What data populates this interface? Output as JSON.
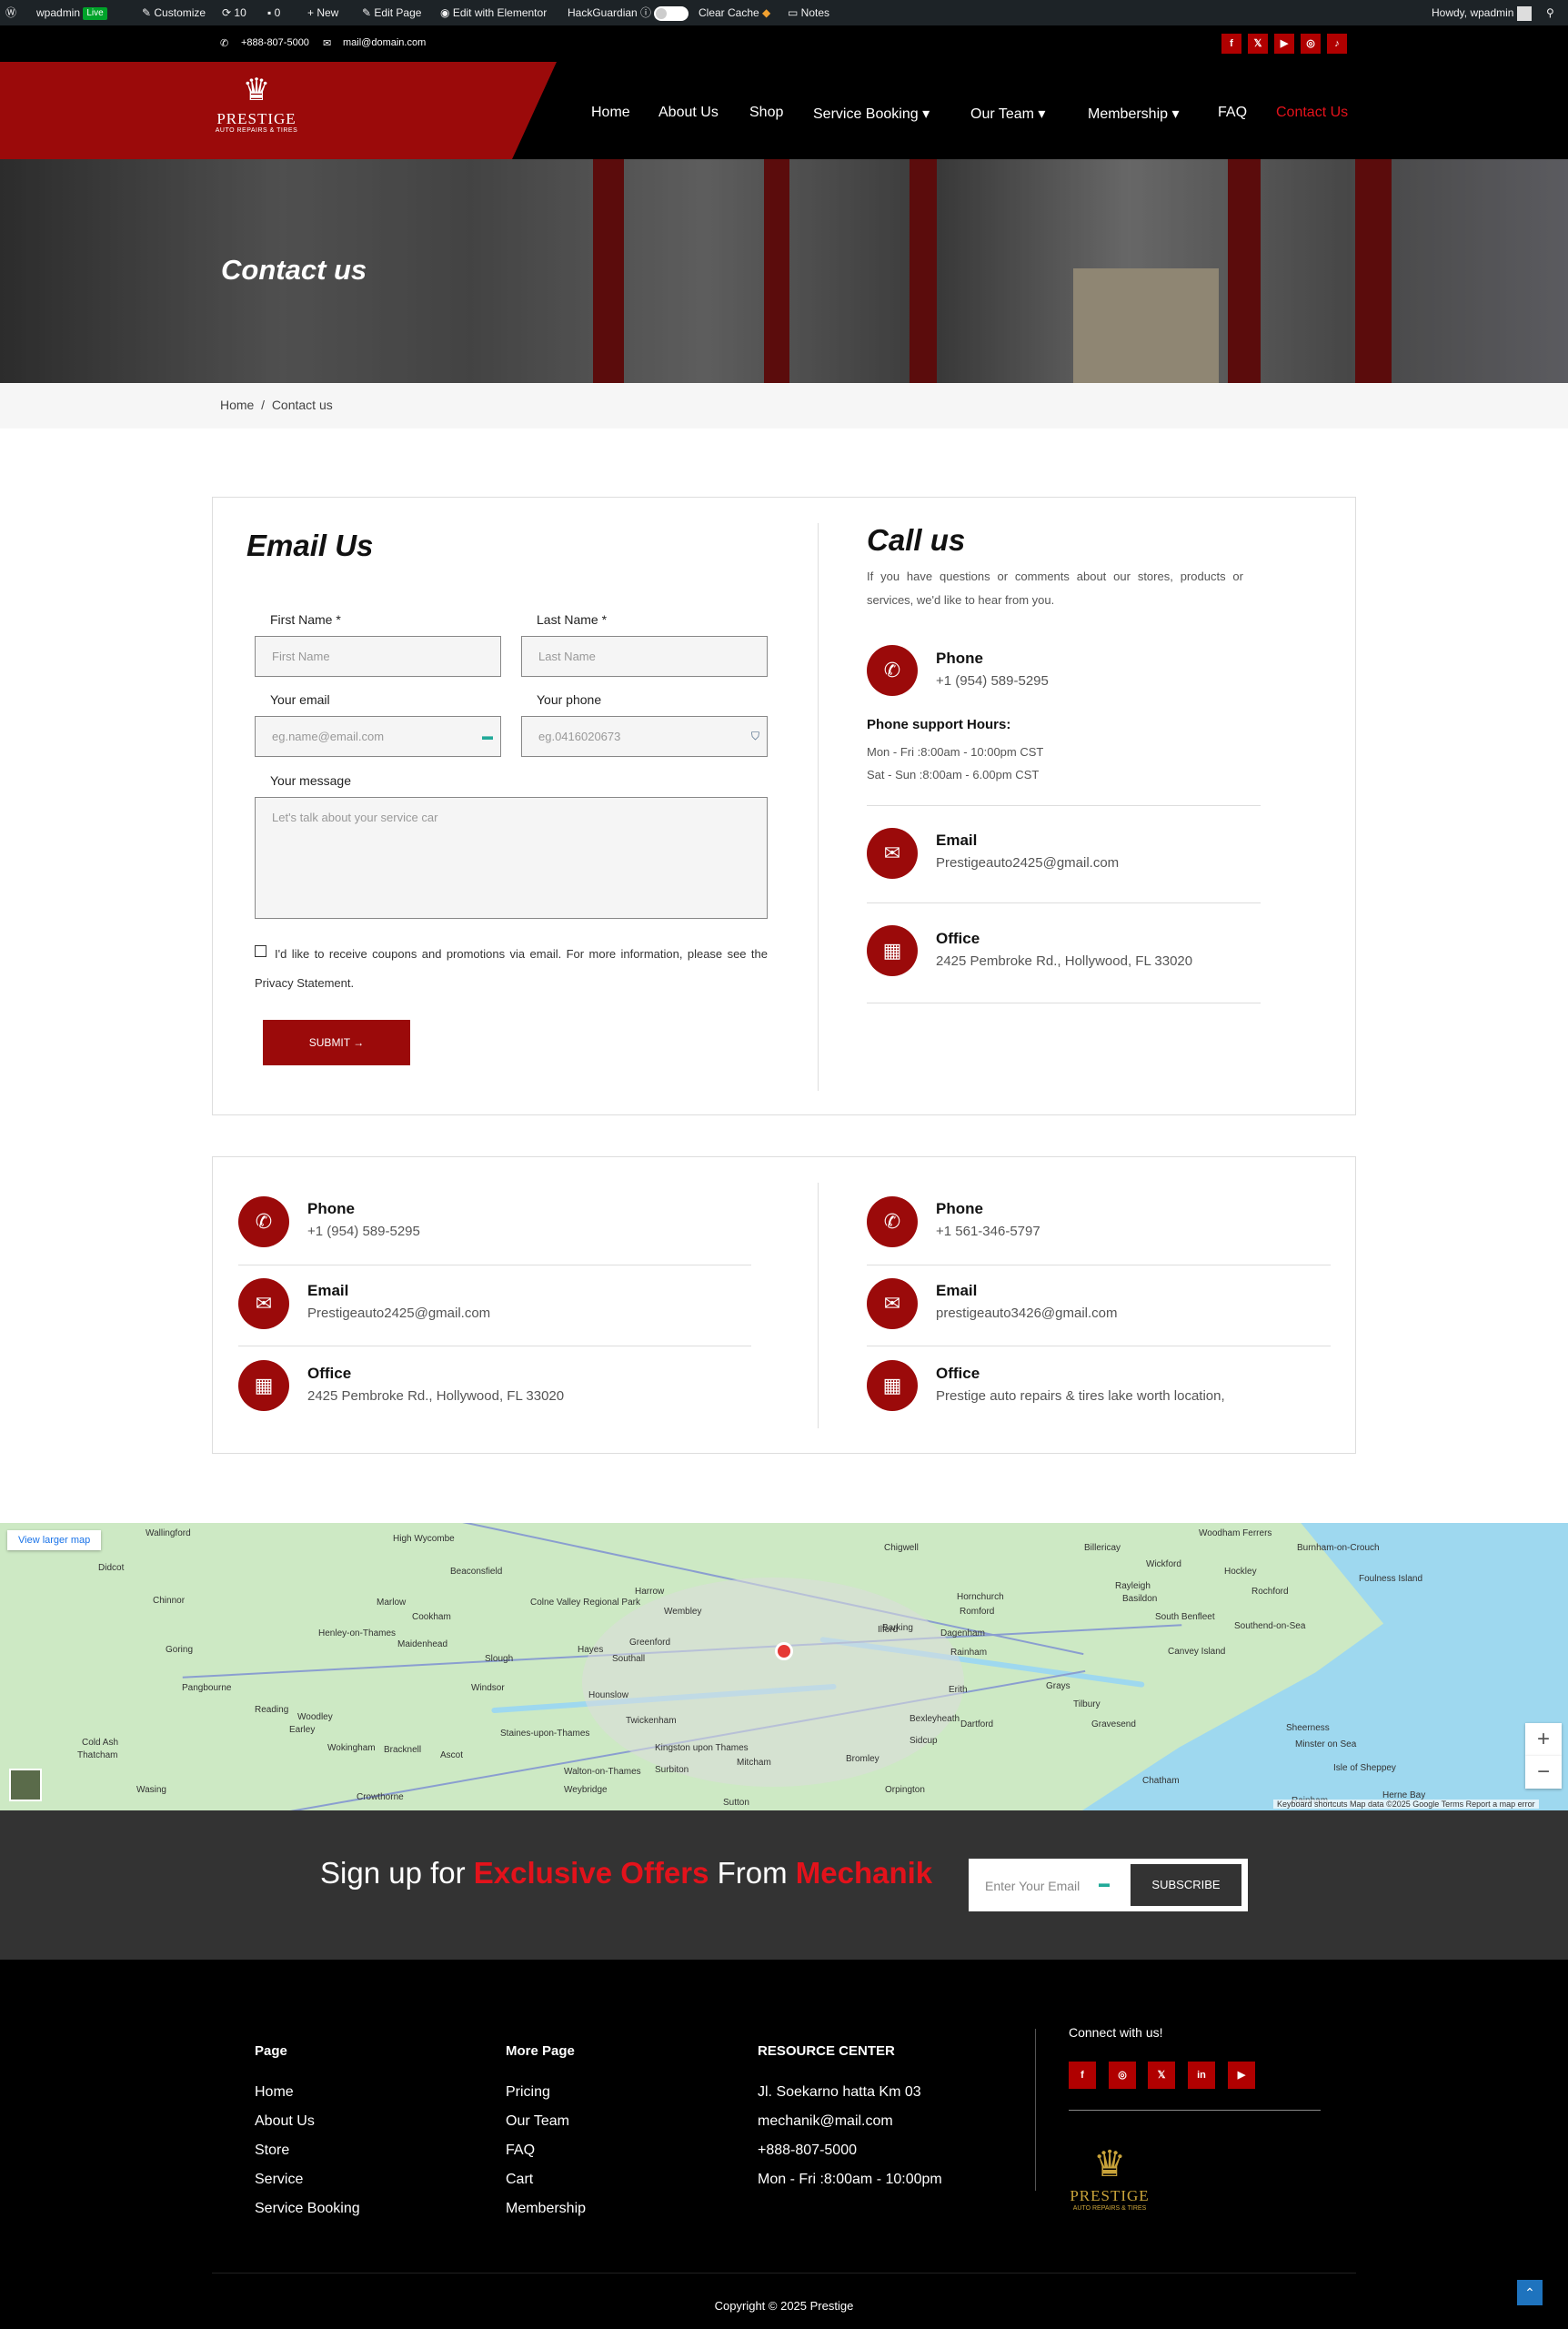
{
  "admin_bar": {
    "site": "wpadmin",
    "live": "Live",
    "customize": "Customize",
    "updates": "10",
    "comments": "0",
    "new": "New",
    "edit_page": "Edit Page",
    "elementor": "Edit with Elementor",
    "hackguardian": "HackGuardian",
    "clear_cache": "Clear Cache",
    "notes": "Notes",
    "howdy": "Howdy, wpadmin"
  },
  "topbar": {
    "phone": "+888-807-5000",
    "email": "mail@domain.com",
    "social": [
      "f",
      "𝕏",
      "▶",
      "◎",
      "♪"
    ]
  },
  "logo": {
    "name": "PRESTIGE",
    "tagline": "AUTO REPAIRS & TIRES"
  },
  "nav": [
    "Home",
    "About Us",
    "Shop",
    "Service Booking",
    "Our Team",
    "Membership",
    "FAQ",
    "Contact Us"
  ],
  "hero": {
    "title": "Contact us"
  },
  "breadcrumb": {
    "home": "Home",
    "sep": "/",
    "current": "Contact us"
  },
  "form": {
    "title": "Email Us",
    "first_label": "First Name",
    "first_placeholder": "First Name",
    "last_label": "Last Name",
    "last_placeholder": "Last Name",
    "required": "*",
    "email_label": "Your email",
    "email_placeholder": "eg.name@email.com",
    "phone_label": "Your phone",
    "phone_placeholder": "eg.0416020673",
    "message_label": "Your message",
    "message_placeholder": "Let's talk about your service car",
    "consent": "I'd like to receive coupons and promotions via email. For more information, please see the Privacy Statement.",
    "submit": "SUBMIT"
  },
  "call": {
    "title": "Call us",
    "intro": "If you have questions or comments about our stores, products or services, we'd like to hear from you.",
    "phone_title": "Phone",
    "phone": "+1 (954) 589-5295",
    "hours_title": "Phone support Hours:",
    "hours_1": "Mon - Fri :8:00am - 10:00pm CST",
    "hours_2": "Sat - Sun :8:00am - 6.00pm CST",
    "email_title": "Email",
    "email": "Prestigeauto2425@gmail.com",
    "office_title": "Office",
    "office": "2425 Pembroke Rd., Hollywood, FL 33020"
  },
  "locations": [
    {
      "phone_title": "Phone",
      "phone": "+1 (954) 589-5295",
      "email_title": "Email",
      "email": "Prestigeauto2425@gmail.com",
      "office_title": "Office",
      "office": "2425 Pembroke Rd., Hollywood, FL 33020"
    },
    {
      "phone_title": "Phone",
      "phone": "+1 561-346-5797",
      "email_title": "Email",
      "email": "prestigeauto3426@gmail.com",
      "office_title": "Office",
      "office": "Prestige auto repairs & tires lake worth location,"
    }
  ],
  "map": {
    "view_larger": "View larger map",
    "towns": [
      "Wallingford",
      "High Wycombe",
      "Beaconsfield",
      "Harrow",
      "Wembley",
      "Chigwell",
      "Billericay",
      "Wickford",
      "Woodham Ferrers",
      "Burnham-on-Crouch",
      "Didcot",
      "Chinnor",
      "Marlow",
      "Cookham",
      "Colne Valley Regional Park",
      "Ilford",
      "Romford",
      "Hornchurch",
      "Rayleigh",
      "Hockley",
      "Rochford",
      "Foulness Island",
      "Henley-on-Thames",
      "Maidenhead",
      "Slough",
      "Southall",
      "Greenford",
      "Barking",
      "Dagenham",
      "Basildon",
      "South Benfleet",
      "Southend-on-Sea",
      "Goring",
      "Pangbourne",
      "Hayes",
      "Rainham",
      "Canvey Island",
      "Reading",
      "Woodley",
      "Windsor",
      "Hounslow",
      "Erith",
      "Grays",
      "Tilbury",
      "Gravesend",
      "Earley",
      "Wokingham",
      "Bracknell",
      "Twickenham",
      "Bexleyheath",
      "Dartford",
      "Sheerness",
      "Minster on Sea",
      "Cold Ash",
      "Thatcham",
      "Staines-upon-Thames",
      "Kingston upon Thames",
      "Mitcham",
      "Sidcup",
      "Isle of Sheppey",
      "Ascot",
      "Walton-on-Thames",
      "Surbiton",
      "Bromley",
      "Chatham",
      "Wasing",
      "Crowthorne",
      "Weybridge",
      "Sutton",
      "Orpington",
      "Rainham",
      "Herne Bay"
    ],
    "attribution": "Keyboard shortcuts   Map data ©2025 Google   Terms   Report a map error"
  },
  "signup": {
    "text1": "Sign up for",
    "highlight": "Exclusive Offers",
    "text2": "From",
    "brand": "Mechanik",
    "placeholder": "Enter Your Email",
    "button": "SUBSCRIBE"
  },
  "footer": {
    "col1_title": "Page",
    "col1": [
      "Home",
      "About Us",
      "Store",
      "Service",
      "Service Booking"
    ],
    "col2_title": "More Page",
    "col2": [
      "Pricing",
      "Our Team",
      "FAQ",
      "Cart",
      "Membership"
    ],
    "col3_title": "RESOURCE CENTER",
    "col3": [
      "Jl. Soekarno hatta Km 03",
      "mechanik@mail.com",
      "+888-807-5000",
      "Mon - Fri :8:00am - 10:00pm"
    ],
    "connect": "Connect with us!",
    "social": [
      "f",
      "◎",
      "𝕏",
      "in",
      "▶"
    ],
    "copyright": "Copyright © 2025 Prestige"
  },
  "colors": {
    "brand_red": "#9b0a0a",
    "accent_red": "#e3121b"
  }
}
